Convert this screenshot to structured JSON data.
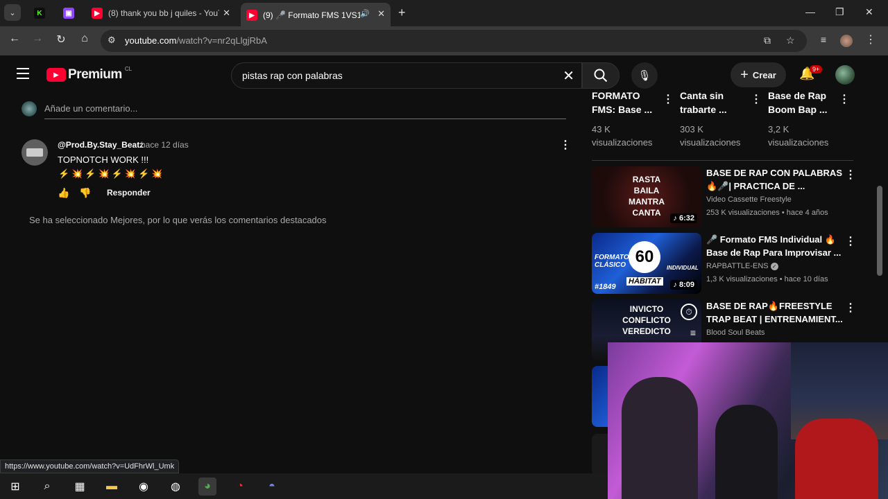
{
  "browser": {
    "tabs": [
      {
        "title": "",
        "favicon": "kick-icon",
        "color": "#53fc18",
        "glyph": "K"
      },
      {
        "title": "",
        "favicon": "twitch-icon",
        "color": "#9146ff",
        "glyph": "▣"
      },
      {
        "title": "(8) thank you bb j quiles - YouT",
        "favicon": "youtube-icon",
        "color": "#ff0033",
        "glyph": "▶"
      },
      {
        "title": "(9) 🎤 Formato FMS 1VS1 🔥",
        "favicon": "youtube-icon",
        "color": "#ff0033",
        "glyph": "▶"
      }
    ],
    "url_host": "youtube.com",
    "url_path": "/watch?v=nr2qLlgjRbA"
  },
  "youtube": {
    "logo": "Premium",
    "region": "CL",
    "search_query": "pistas rap con palabras",
    "create_label": "Crear",
    "notif_badge": "9+"
  },
  "comments": {
    "placeholder": "Añade un comentario...",
    "items": [
      {
        "author": "@Prod.By.Stay_Beatz",
        "time": "hace 12 días",
        "text": "TOPNOTCH WORK !!!",
        "emoji": "⚡💥⚡💥⚡💥⚡💥",
        "reply_label": "Responder"
      }
    ],
    "sort_note": "Se ha seleccionado Mejores, por lo que verás los comentarios destacados"
  },
  "shelf": [
    {
      "title": "FORMATO FMS: Base ...",
      "views_line1": "43 K",
      "views_line2": "visualizaciones"
    },
    {
      "title": "Canta sin trabarte ...",
      "views_line1": "303 K",
      "views_line2": "visualizaciones"
    },
    {
      "title": "Base de Rap Boom Bap ...",
      "views_line1": "3,2 K",
      "views_line2": "visualizaciones"
    }
  ],
  "related": [
    {
      "title": "BASE DE RAP CON PALABRAS 🔥🎤| PRACTICA DE ...",
      "channel": "Video Cassette Freestyle",
      "stats": "253 K visualizaciones • hace 4 años",
      "duration": "6:32",
      "thumb_text": [
        "RASTA",
        "BAILA",
        "MANTRA",
        "CANTA"
      ]
    },
    {
      "title": "🎤 Formato FMS Individual 🔥 Base de Rap Para Improvisar ...",
      "channel": "RAPBATTLE-ENS",
      "stats": "1,3 K visualizaciones • hace 10 días",
      "duration": "8:09",
      "thumb_text": [
        "FORMATO",
        "CLÁSICO",
        "60",
        "INDIVIDUAL",
        "HÁBITAT",
        "#1849"
      ]
    },
    {
      "title": "BASE DE RAP🔥FREESTYLE TRAP BEAT | ENTRENAMIENT...",
      "channel": "Blood Soul Beats",
      "stats": "",
      "duration": "",
      "thumb_text": [
        "INVICTO",
        "CONFLICTO",
        "VEREDICTO"
      ]
    }
  ],
  "status_url": "https://www.youtube.com/watch?v=UdFhrWl_Umk"
}
